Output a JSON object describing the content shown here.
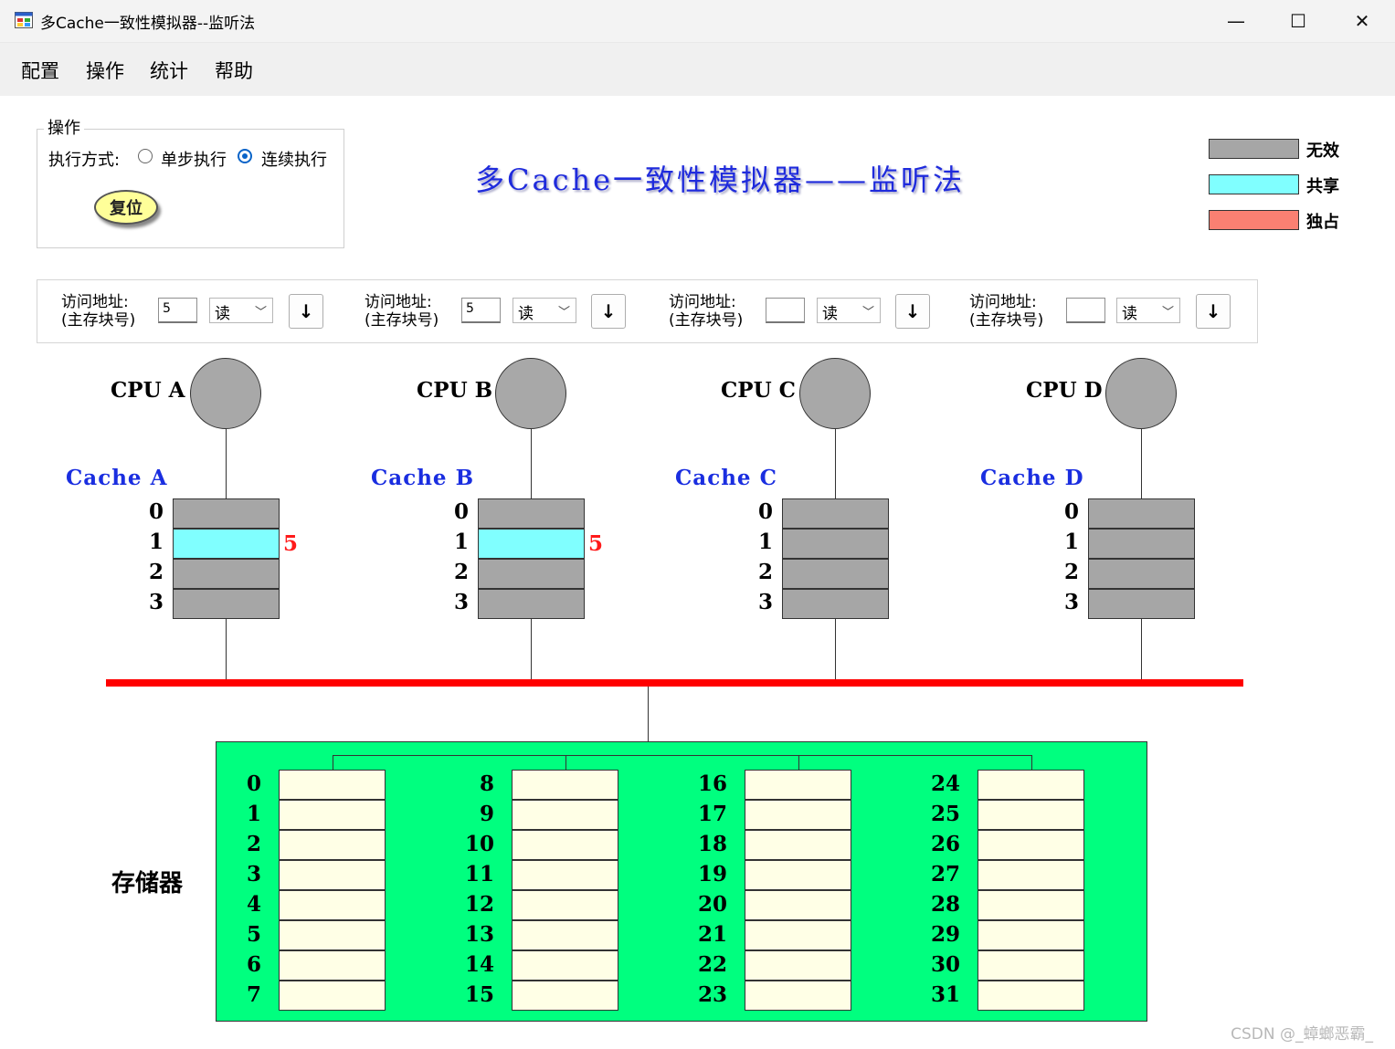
{
  "window": {
    "title": "多Cache一致性模拟器--监听法",
    "controls": {
      "minimize": "—",
      "maximize": "☐",
      "close": "✕"
    }
  },
  "menu": [
    "配置",
    "操作",
    "统计",
    "帮助"
  ],
  "operation": {
    "group_label": "操作",
    "mode_label": "执行方式:",
    "options": [
      "单步执行",
      "连续执行"
    ],
    "selected": "连续执行",
    "reset_label": "复位"
  },
  "main_title": "多Cache一致性模拟器——监听法",
  "legend": [
    {
      "label": "无效",
      "color": "#a6a6a6"
    },
    {
      "label": "共享",
      "color": "#80ffff"
    },
    {
      "label": "独占",
      "color": "#fa8072"
    }
  ],
  "access": {
    "label_line1": "访问地址:",
    "label_line2": "(主存块号)",
    "button_glyph": "↓",
    "select_chevron": "﹀",
    "panels": [
      {
        "address": "5",
        "operation": "读"
      },
      {
        "address": "5",
        "operation": "读"
      },
      {
        "address": "",
        "operation": "读"
      },
      {
        "address": "",
        "operation": "读"
      }
    ]
  },
  "cpus": [
    {
      "label": "CPU A",
      "cache_label": "Cache A",
      "blocks": [
        {
          "index": "0",
          "state": "invalid",
          "tag": ""
        },
        {
          "index": "1",
          "state": "shared",
          "tag": "5"
        },
        {
          "index": "2",
          "state": "invalid",
          "tag": ""
        },
        {
          "index": "3",
          "state": "invalid",
          "tag": ""
        }
      ]
    },
    {
      "label": "CPU B",
      "cache_label": "Cache B",
      "blocks": [
        {
          "index": "0",
          "state": "invalid",
          "tag": ""
        },
        {
          "index": "1",
          "state": "shared",
          "tag": "5"
        },
        {
          "index": "2",
          "state": "invalid",
          "tag": ""
        },
        {
          "index": "3",
          "state": "invalid",
          "tag": ""
        }
      ]
    },
    {
      "label": "CPU C",
      "cache_label": "Cache C",
      "blocks": [
        {
          "index": "0",
          "state": "invalid",
          "tag": ""
        },
        {
          "index": "1",
          "state": "invalid",
          "tag": ""
        },
        {
          "index": "2",
          "state": "invalid",
          "tag": ""
        },
        {
          "index": "3",
          "state": "invalid",
          "tag": ""
        }
      ]
    },
    {
      "label": "CPU D",
      "cache_label": "Cache D",
      "blocks": [
        {
          "index": "0",
          "state": "invalid",
          "tag": ""
        },
        {
          "index": "1",
          "state": "invalid",
          "tag": ""
        },
        {
          "index": "2",
          "state": "invalid",
          "tag": ""
        },
        {
          "index": "3",
          "state": "invalid",
          "tag": ""
        }
      ]
    }
  ],
  "memory": {
    "label": "存储器",
    "columns": [
      [
        "0",
        "1",
        "2",
        "3",
        "4",
        "5",
        "6",
        "7"
      ],
      [
        "8",
        "9",
        "10",
        "11",
        "12",
        "13",
        "14",
        "15"
      ],
      [
        "16",
        "17",
        "18",
        "19",
        "20",
        "21",
        "22",
        "23"
      ],
      [
        "24",
        "25",
        "26",
        "27",
        "28",
        "29",
        "30",
        "31"
      ]
    ]
  },
  "watermark": "CSDN @_蟑螂恶霸_"
}
